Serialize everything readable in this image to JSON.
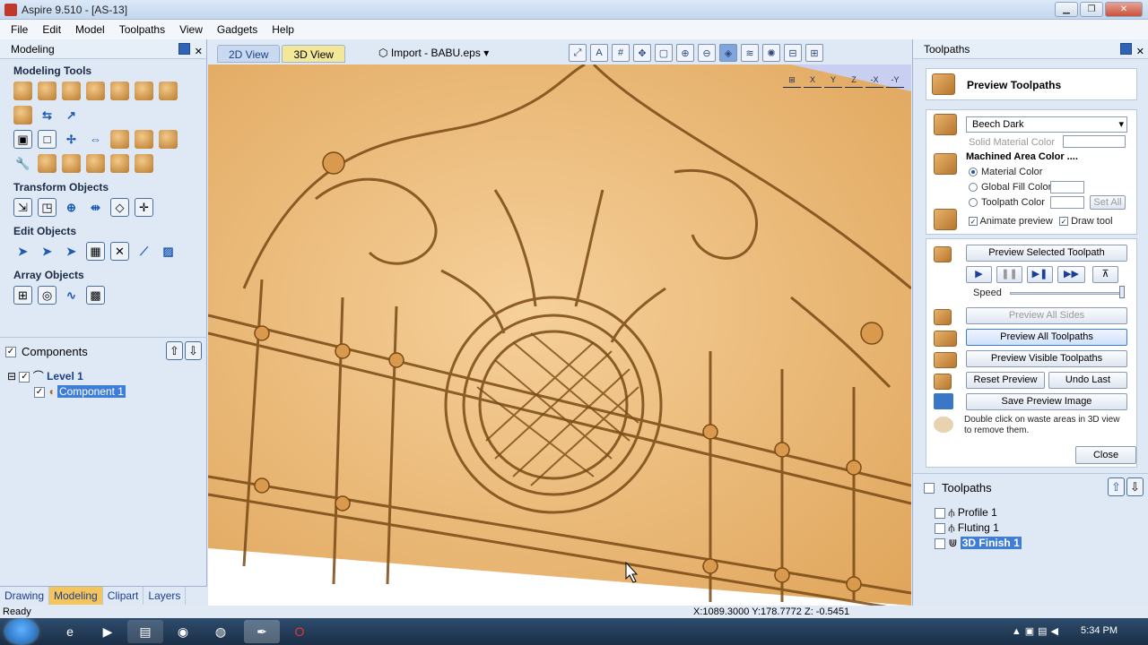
{
  "window": {
    "title": "Aspire 9.510 - [AS-13]"
  },
  "menu": [
    "File",
    "Edit",
    "Model",
    "Toolpaths",
    "View",
    "Gadgets",
    "Help"
  ],
  "left_panel": {
    "title": "Modeling",
    "sections": {
      "modeling_tools": "Modeling Tools",
      "transform": "Transform Objects",
      "edit": "Edit Objects",
      "array": "Array Objects"
    },
    "components_label": "Components",
    "tree": {
      "level": "Level 1",
      "component": "Component 1"
    },
    "tabs": [
      "Drawing",
      "Modeling",
      "Clipart",
      "Layers"
    ]
  },
  "center": {
    "tabs": [
      "2D View",
      "3D View"
    ],
    "import_label": "Import - BABU.eps",
    "axes": [
      "X",
      "Y",
      "Z",
      "-X",
      "-Y"
    ]
  },
  "right_panel": {
    "title": "Toolpaths",
    "preview_title": "Preview Toolpaths",
    "material": "Beech Dark",
    "solid_material_color": "Solid Material Color",
    "machined_area_color": "Machined Area Color ....",
    "material_color": "Material Color",
    "global_fill_color": "Global Fill Color",
    "toolpath_color": "Toolpath Color",
    "set_all": "Set All",
    "animate_preview": "Animate preview",
    "draw_tool": "Draw tool",
    "preview_selected": "Preview Selected Toolpath",
    "speed": "Speed",
    "preview_all_sides": "Preview All Sides",
    "preview_all": "Preview All Toolpaths",
    "preview_visible": "Preview Visible Toolpaths",
    "reset_preview": "Reset Preview",
    "undo_last": "Undo Last",
    "save_image": "Save Preview Image",
    "hint": "Double click on waste areas in 3D view to remove them.",
    "close": "Close",
    "toolpaths_label": "Toolpaths",
    "toolpath_list": [
      "Profile 1",
      "Fluting 1",
      "3D Finish 1"
    ]
  },
  "status": {
    "ready": "Ready",
    "coords": "X:1089.3000 Y:178.7772 Z: -0.5451"
  },
  "taskbar": {
    "time": "5:34 PM"
  }
}
